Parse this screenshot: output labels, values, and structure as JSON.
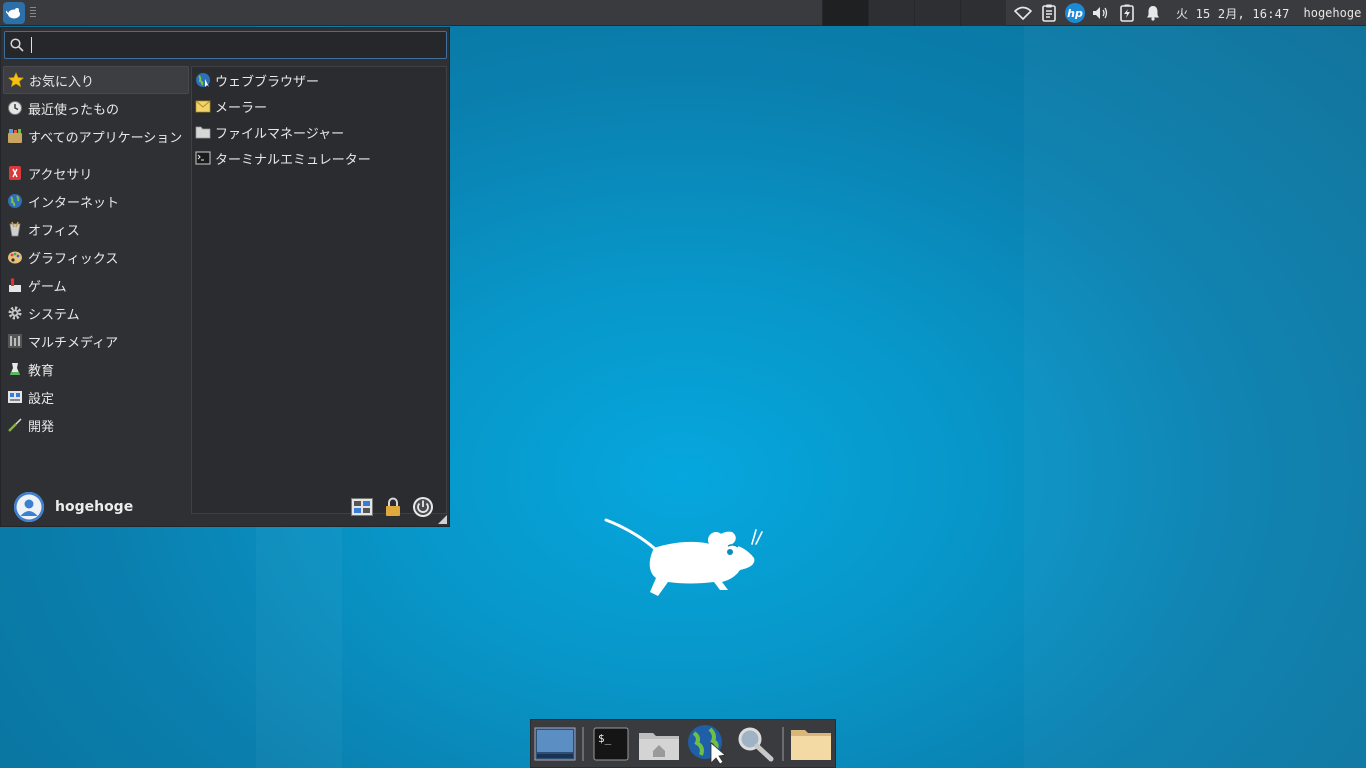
{
  "panel": {
    "clock": "火 15  2月, 16:47",
    "username": "hogehoge",
    "workspaces": 4
  },
  "menu": {
    "search": {
      "value": "",
      "placeholder": ""
    },
    "categories_top": [
      {
        "label": "お気に入り",
        "icon": "star-icon",
        "selected": true
      },
      {
        "label": "最近使ったもの",
        "icon": "clock-icon"
      },
      {
        "label": "すべてのアプリケーション",
        "icon": "applications-icon"
      }
    ],
    "categories": [
      {
        "label": "アクセサリ",
        "icon": "accessories-icon"
      },
      {
        "label": "インターネット",
        "icon": "internet-globe-icon"
      },
      {
        "label": "オフィス",
        "icon": "office-icon"
      },
      {
        "label": "グラフィックス",
        "icon": "graphics-palette-icon"
      },
      {
        "label": "ゲーム",
        "icon": "game-icon"
      },
      {
        "label": "システム",
        "icon": "system-gear-icon"
      },
      {
        "label": "マルチメディア",
        "icon": "multimedia-icon"
      },
      {
        "label": "教育",
        "icon": "education-icon"
      },
      {
        "label": "設定",
        "icon": "settings-icon"
      },
      {
        "label": "開発",
        "icon": "development-icon"
      }
    ],
    "apps": [
      {
        "label": "ウェブブラウザー",
        "icon": "web-browser-icon"
      },
      {
        "label": "メーラー",
        "icon": "mail-icon"
      },
      {
        "label": "ファイルマネージャー",
        "icon": "folder-icon"
      },
      {
        "label": "ターミナルエミュレーター",
        "icon": "terminal-icon"
      }
    ],
    "footer": {
      "username": "hogehoge"
    }
  },
  "colors": {
    "panel_bg": "#3a3b3e",
    "menu_bg": "#2f3033",
    "accent": "#3f6f9c",
    "wallpaper": "#0896c8"
  }
}
